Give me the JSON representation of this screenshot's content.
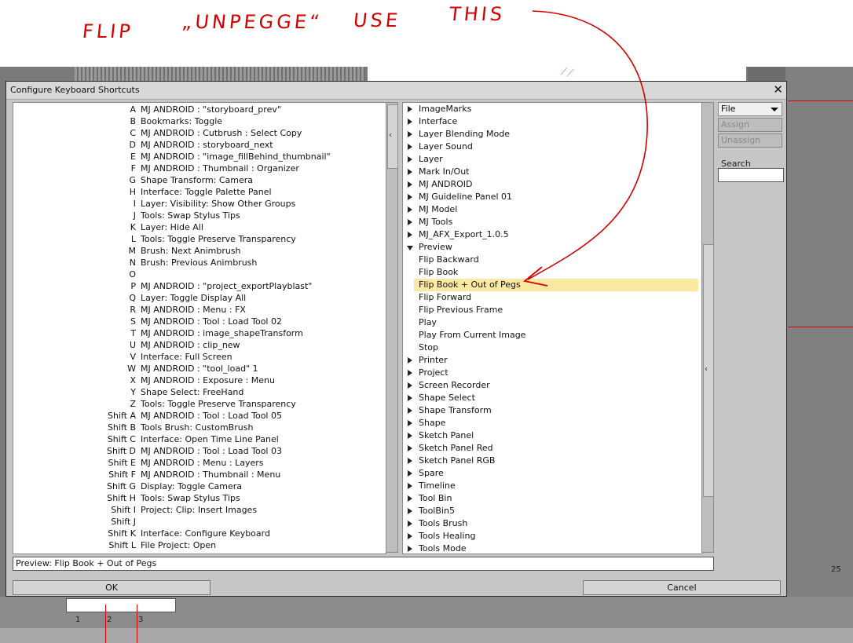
{
  "annotation": {
    "words": [
      "FLIP",
      "„UNPEGGE“",
      "USE",
      "THIS"
    ]
  },
  "ruler": {
    "value_right": "25",
    "ticks": [
      "1",
      "2",
      "3"
    ]
  },
  "dialog": {
    "title": "Configure Keyboard Shortcuts",
    "close": "✕"
  },
  "shortcuts": [
    {
      "key": "A",
      "action": "MJ ANDROID : \"storyboard_prev\""
    },
    {
      "key": "B",
      "action": "Bookmarks: Toggle"
    },
    {
      "key": "C",
      "action": "MJ ANDROID : Cutbrush : Select Copy"
    },
    {
      "key": "D",
      "action": "MJ ANDROID : storyboard_next"
    },
    {
      "key": "E",
      "action": "MJ ANDROID : \"image_fillBehind_thumbnail\""
    },
    {
      "key": "F",
      "action": "MJ ANDROID : Thumbnail : Organizer"
    },
    {
      "key": "G",
      "action": "Shape Transform: Camera"
    },
    {
      "key": "H",
      "action": "Interface: Toggle Palette Panel"
    },
    {
      "key": "I",
      "action": "Layer: Visibility: Show Other Groups"
    },
    {
      "key": "J",
      "action": "Tools: Swap Stylus Tips"
    },
    {
      "key": "K",
      "action": "Layer: Hide All"
    },
    {
      "key": "L",
      "action": "Tools: Toggle Preserve Transparency"
    },
    {
      "key": "M",
      "action": "Brush: Next Animbrush"
    },
    {
      "key": "N",
      "action": "Brush: Previous Animbrush"
    },
    {
      "key": "O",
      "action": ""
    },
    {
      "key": "P",
      "action": "MJ ANDROID : \"project_exportPlayblast\""
    },
    {
      "key": "Q",
      "action": "Layer: Toggle Display All"
    },
    {
      "key": "R",
      "action": "MJ ANDROID : Menu : FX"
    },
    {
      "key": "S",
      "action": "MJ ANDROID : Tool : Load Tool 02"
    },
    {
      "key": "T",
      "action": "MJ ANDROID : image_shapeTransform"
    },
    {
      "key": "U",
      "action": "MJ ANDROID : clip_new"
    },
    {
      "key": "V",
      "action": "Interface: Full Screen"
    },
    {
      "key": "W",
      "action": "MJ ANDROID : \"tool_load\" 1"
    },
    {
      "key": "X",
      "action": "MJ ANDROID : Exposure : Menu"
    },
    {
      "key": "Y",
      "action": "Shape Select: FreeHand"
    },
    {
      "key": "Z",
      "action": "Tools: Toggle Preserve Transparency"
    },
    {
      "key": "Shift A",
      "action": "MJ ANDROID : Tool : Load Tool 05"
    },
    {
      "key": "Shift B",
      "action": "Tools Brush: CustomBrush"
    },
    {
      "key": "Shift C",
      "action": "Interface: Open Time Line Panel"
    },
    {
      "key": "Shift D",
      "action": "MJ ANDROID : Tool : Load Tool 03"
    },
    {
      "key": "Shift E",
      "action": "MJ ANDROID : Menu : Layers"
    },
    {
      "key": "Shift F",
      "action": "MJ ANDROID : Thumbnail : Menu"
    },
    {
      "key": "Shift G",
      "action": "Display: Toggle Camera"
    },
    {
      "key": "Shift H",
      "action": "Tools: Swap Stylus Tips"
    },
    {
      "key": "Shift I",
      "action": "Project: Clip: Insert Images"
    },
    {
      "key": "Shift J",
      "action": ""
    },
    {
      "key": "Shift K",
      "action": "Interface: Configure Keyboard"
    },
    {
      "key": "Shift L",
      "action": "File Project: Open"
    }
  ],
  "tree": [
    {
      "label": "ImageMarks",
      "type": "collapsed"
    },
    {
      "label": "Interface",
      "type": "collapsed"
    },
    {
      "label": "Layer Blending Mode",
      "type": "collapsed"
    },
    {
      "label": "Layer Sound",
      "type": "collapsed"
    },
    {
      "label": "Layer",
      "type": "collapsed"
    },
    {
      "label": "Mark In/Out",
      "type": "collapsed"
    },
    {
      "label": "MJ ANDROID",
      "type": "collapsed"
    },
    {
      "label": "MJ Guideline Panel 01",
      "type": "collapsed"
    },
    {
      "label": "MJ Model",
      "type": "collapsed"
    },
    {
      "label": "MJ Tools",
      "type": "collapsed"
    },
    {
      "label": "MJ_AFX_Export_1.0.5",
      "type": "collapsed"
    },
    {
      "label": "Preview",
      "type": "expanded"
    },
    {
      "label": "Flip Backward",
      "type": "child"
    },
    {
      "label": "Flip Book",
      "type": "child"
    },
    {
      "label": "Flip Book + Out of Pegs",
      "type": "child",
      "selected": true
    },
    {
      "label": "Flip Forward",
      "type": "child"
    },
    {
      "label": "Flip Previous Frame",
      "type": "child"
    },
    {
      "label": "Play",
      "type": "child"
    },
    {
      "label": "Play From Current Image",
      "type": "child"
    },
    {
      "label": "Stop",
      "type": "child"
    },
    {
      "label": "Printer",
      "type": "collapsed"
    },
    {
      "label": "Project",
      "type": "collapsed"
    },
    {
      "label": "Screen Recorder",
      "type": "collapsed"
    },
    {
      "label": "Shape Select",
      "type": "collapsed"
    },
    {
      "label": "Shape Transform",
      "type": "collapsed"
    },
    {
      "label": "Shape",
      "type": "collapsed"
    },
    {
      "label": "Sketch Panel",
      "type": "collapsed"
    },
    {
      "label": "Sketch Panel Red",
      "type": "collapsed"
    },
    {
      "label": "Sketch Panel RGB",
      "type": "collapsed"
    },
    {
      "label": "Spare",
      "type": "collapsed"
    },
    {
      "label": "Timeline",
      "type": "collapsed"
    },
    {
      "label": "Tool Bin",
      "type": "collapsed"
    },
    {
      "label": "ToolBin5",
      "type": "collapsed"
    },
    {
      "label": "Tools Brush",
      "type": "collapsed"
    },
    {
      "label": "Tools Healing",
      "type": "collapsed"
    },
    {
      "label": "Tools Mode",
      "type": "collapsed"
    }
  ],
  "side": {
    "category_select": "File",
    "assign_label": "Assign",
    "unassign_label": "Unassign",
    "search_label": "Search",
    "search_value": ""
  },
  "status_text": "Preview: Flip Book + Out of Pegs",
  "ok_label": "OK",
  "cancel_label": "Cancel",
  "colors": {
    "annotation_red": "#d40000",
    "selection_highlight": "#fbe9a2",
    "dialog_bg": "#c6c6c6"
  }
}
